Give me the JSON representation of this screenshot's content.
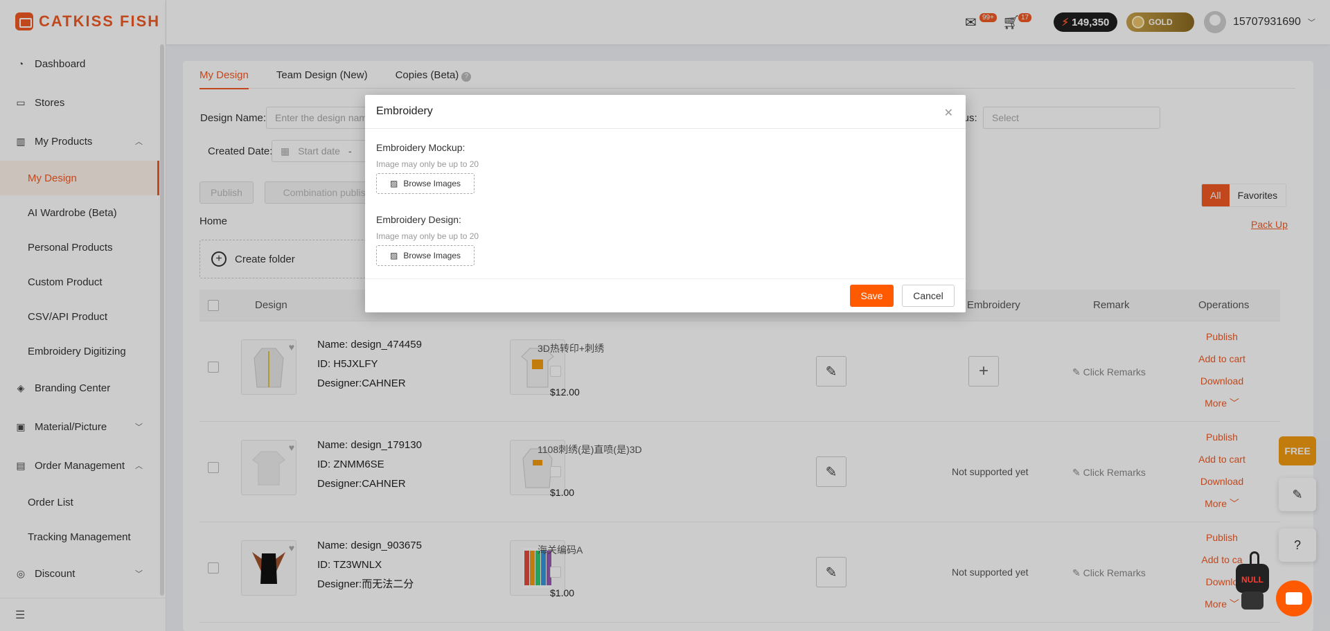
{
  "brand": {
    "name": "CATKISS FISH"
  },
  "sidebar": {
    "items": [
      {
        "label": "Dashboard",
        "icon": "dashboard-icon"
      },
      {
        "label": "Stores",
        "icon": "store-icon"
      },
      {
        "label": "My Products",
        "icon": "products-icon",
        "expanded": true
      },
      {
        "label": "Branding Center",
        "icon": "tag-icon"
      },
      {
        "label": "Material/Picture",
        "icon": "image-icon",
        "expanded": false
      },
      {
        "label": "Order Management",
        "icon": "order-icon",
        "expanded": true
      },
      {
        "label": "Discount",
        "icon": "discount-icon",
        "expanded": false
      }
    ],
    "products_sub": [
      "My Design",
      "AI Wardrobe (Beta)",
      "Personal Products",
      "Custom Product",
      "CSV/API Product",
      "Embroidery Digitizing"
    ],
    "orders_sub": [
      "Order List",
      "Tracking Management"
    ],
    "active": "My Design"
  },
  "header": {
    "mail_badge": "99+",
    "cart_badge": "17",
    "points": "149,350",
    "level": "GOLD",
    "username": "15707931690"
  },
  "tabs": [
    {
      "label": "My Design",
      "active": true
    },
    {
      "label": "Team Design (New)"
    },
    {
      "label": "Copies (Beta)"
    }
  ],
  "filters": {
    "design_name_label": "Design Name:",
    "design_name_placeholder": "Enter the design name",
    "status_label": "Status:",
    "status_placeholder": "Select",
    "created_label": "Created Date:",
    "start_placeholder": "Start date",
    "date_sep": "-"
  },
  "actions": {
    "publish": "Publish",
    "combination_publish": "Combination publish",
    "all": "All",
    "favorites": "Favorites",
    "pack_up": "Pack Up",
    "home": "Home",
    "create_folder": "Create folder"
  },
  "table": {
    "headers": {
      "design": "Design",
      "embroidery": "Embroidery",
      "remark": "Remark",
      "operations": "Operations"
    },
    "rows": [
      {
        "name": "Name:  design_474459",
        "id": "ID: H5JXLFY",
        "designer": "Designer:CAHNER",
        "product": "3D热转印+刺绣",
        "price": "$12.00",
        "embroidery": "+",
        "remark": "Click Remarks"
      },
      {
        "name": "Name:  design_179130",
        "id": "ID: ZNMM6SE",
        "designer": "Designer:CAHNER",
        "product": "1108刺绣(是)直喷(是)3D",
        "price": "$1.00",
        "embroidery": "Not supported yet",
        "remark": "Click Remarks"
      },
      {
        "name": "Name:  design_903675",
        "id": "ID: TZ3WNLX",
        "designer": "Designer:而无法二分",
        "product": "海关编码A",
        "price": "$1.00",
        "embroidery": "Not supported yet",
        "remark": "Click Remarks"
      }
    ],
    "ops": {
      "publish": "Publish",
      "add_to_cart": "Add to cart",
      "download": "Download",
      "more": "More"
    },
    "ops_row3_truncated": {
      "add_to_cart": "Add to ca",
      "download": "Downlo"
    }
  },
  "modal": {
    "title": "Embroidery",
    "mockup_label": "Embroidery Mockup:",
    "mockup_hint": "Image may only be up to 20",
    "design_label": "Embroidery Design:",
    "design_hint": "Image may only be up to 20",
    "browse": "Browse Images",
    "save": "Save",
    "cancel": "Cancel"
  },
  "widgets": {
    "free": "FREE",
    "robot_text": "NULL"
  },
  "colors": {
    "accent": "#f15a24",
    "save": "#ff5a00"
  }
}
